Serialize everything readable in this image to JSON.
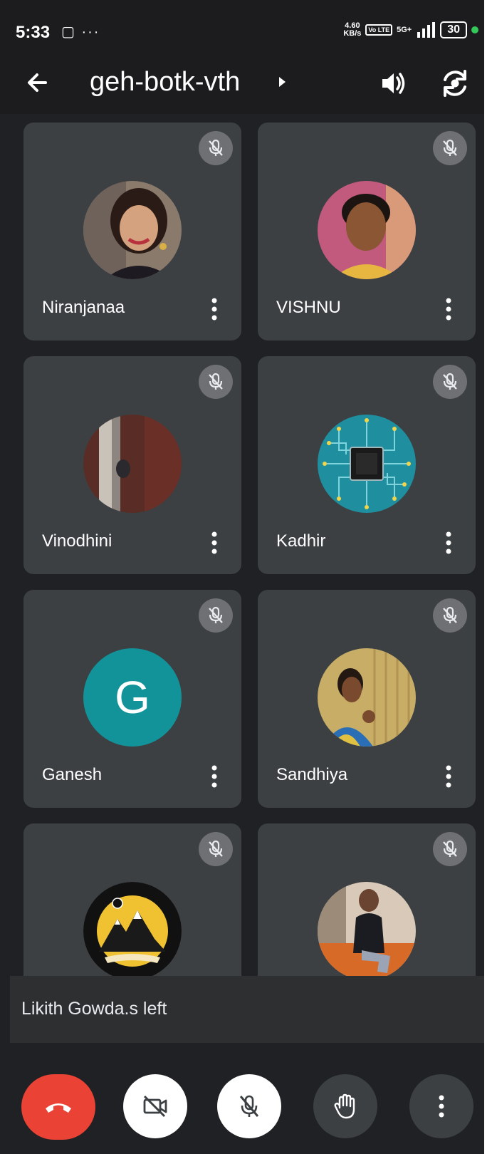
{
  "status_bar": {
    "time": "5:33",
    "left_icons": "▢ ···",
    "net_speed_value": "4.60",
    "net_speed_unit": "KB/s",
    "volte": "Vo LTE",
    "signal": "5G+",
    "battery": "30",
    "active_indicator_color": "#34c759"
  },
  "header": {
    "title": "geh-botk-vth",
    "back_icon": "arrow-left-icon",
    "speaker_icon": "speaker-icon",
    "flip_icon": "camera-flip-icon"
  },
  "participants": [
    {
      "name": "Niranjanaa",
      "muted": true,
      "avatar": "photo"
    },
    {
      "name": "VISHNU",
      "muted": true,
      "avatar": "photo"
    },
    {
      "name": "Vinodhini",
      "muted": true,
      "avatar": "photo"
    },
    {
      "name": "Kadhir",
      "muted": true,
      "avatar": "circuit-chip-image"
    },
    {
      "name": "Ganesh",
      "muted": true,
      "avatar": "letter",
      "letter": "G",
      "avatar_color": "#12939a"
    },
    {
      "name": "Sandhiya",
      "muted": true,
      "avatar": "photo"
    },
    {
      "name": "",
      "muted": true,
      "avatar": "college-logo-image"
    },
    {
      "name": "",
      "muted": true,
      "avatar": "photo"
    }
  ],
  "toast": {
    "message": "Likith Gowda.s left"
  },
  "controls": {
    "end_call_color": "#ea4335",
    "buttons": [
      "end-call-icon",
      "camera-off-icon",
      "mic-off-icon",
      "raise-hand-icon",
      "more-vert-icon"
    ]
  }
}
